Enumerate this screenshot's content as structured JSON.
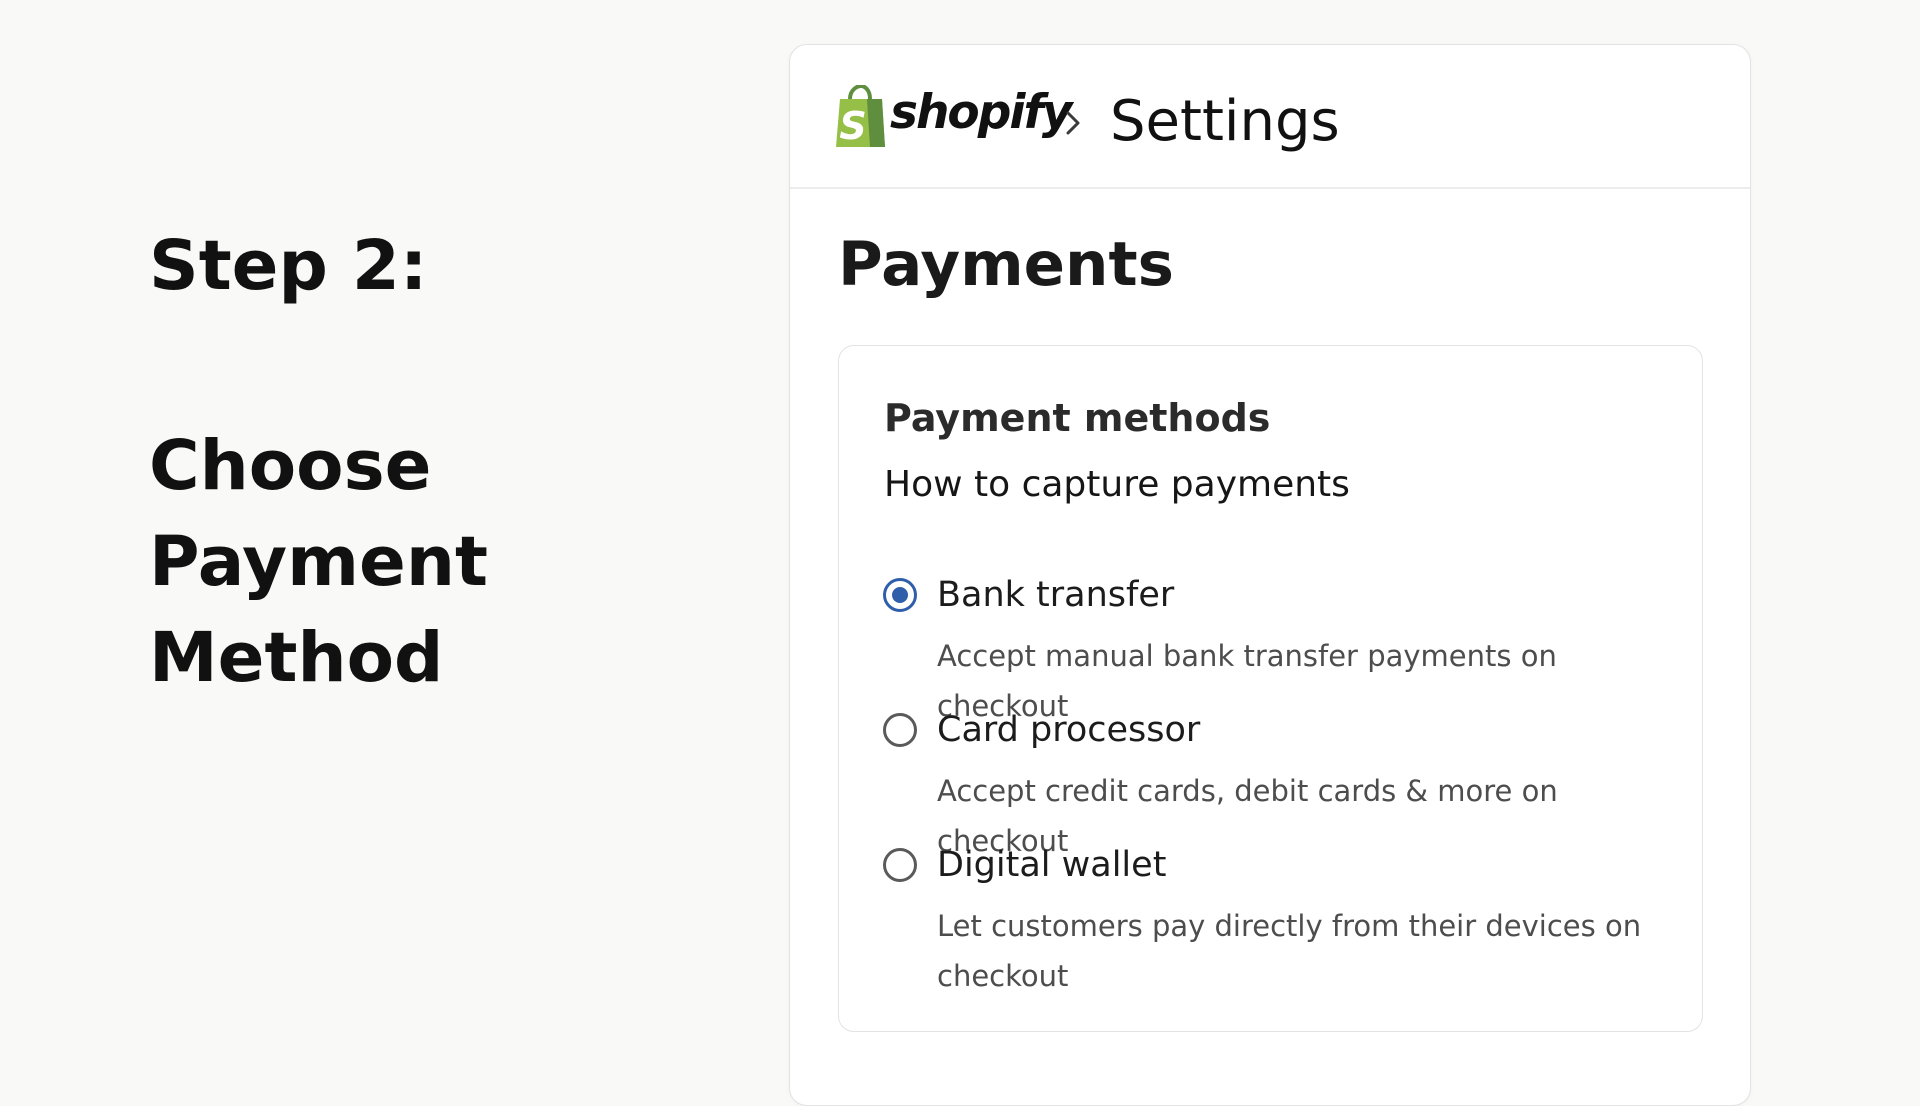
{
  "instructions": {
    "step": "Step 2:",
    "title": "Choose Payment Method"
  },
  "header": {
    "brand": "shopify",
    "breadcrumb_separator_icon": "chevron-right-icon",
    "section": "Settings"
  },
  "page": {
    "title": "Payments"
  },
  "payment_methods": {
    "title": "Payment methods",
    "subtitle": "How to capture payments",
    "options": [
      {
        "label": "Bank transfer",
        "description": "Accept manual bank transfer payments on checkout",
        "selected": true
      },
      {
        "label": "Card processor",
        "description": "Accept credit cards, debit cards & more on checkout",
        "selected": false
      },
      {
        "label": "Digital wallet",
        "description": "Let customers pay directly from their devices on checkout",
        "selected": false
      }
    ]
  },
  "colors": {
    "brand_green": "#95bf47",
    "brand_green_dark": "#5e8e3e",
    "radio_selected": "#2f5eaa"
  }
}
